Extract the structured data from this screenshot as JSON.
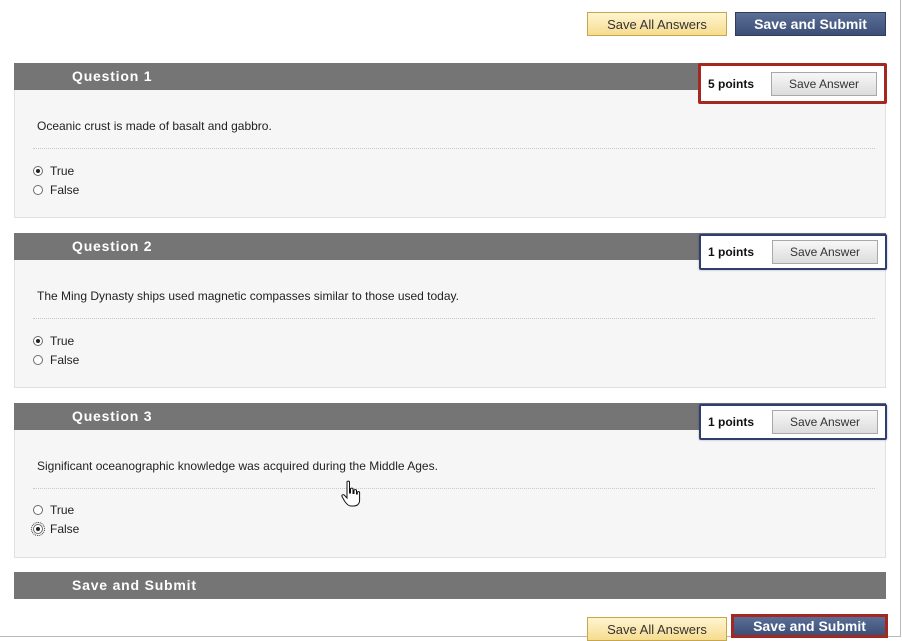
{
  "toolbar": {
    "save_all_label": "Save All Answers",
    "save_submit_label": "Save and Submit"
  },
  "questions": [
    {
      "title": "Question 1",
      "points": "5 points",
      "save_label": "Save Answer",
      "text": "Oceanic crust is made of basalt and gabbro.",
      "options": [
        "True",
        "False"
      ],
      "selected": "True"
    },
    {
      "title": "Question 2",
      "points": "1 points",
      "save_label": "Save Answer",
      "text": "The Ming Dynasty ships used magnetic compasses similar to those used today.",
      "options": [
        "True",
        "False"
      ],
      "selected": "True"
    },
    {
      "title": "Question 3",
      "points": "1 points",
      "save_label": "Save Answer",
      "text": "Significant oceanographic knowledge was acquired during the Middle Ages.",
      "options": [
        "True",
        "False"
      ],
      "selected": "False"
    }
  ],
  "submit_section": {
    "title": "Save and Submit"
  },
  "colors": {
    "header_bar": "#757575",
    "primary_button": "#3d4f76",
    "secondary_button": "#f6dc8f",
    "highlight_red": "#a4281f",
    "highlight_blue": "#2f3d74"
  },
  "icons": {
    "cursor": "hand-pointer-icon",
    "radio": "radio-button-icon"
  }
}
